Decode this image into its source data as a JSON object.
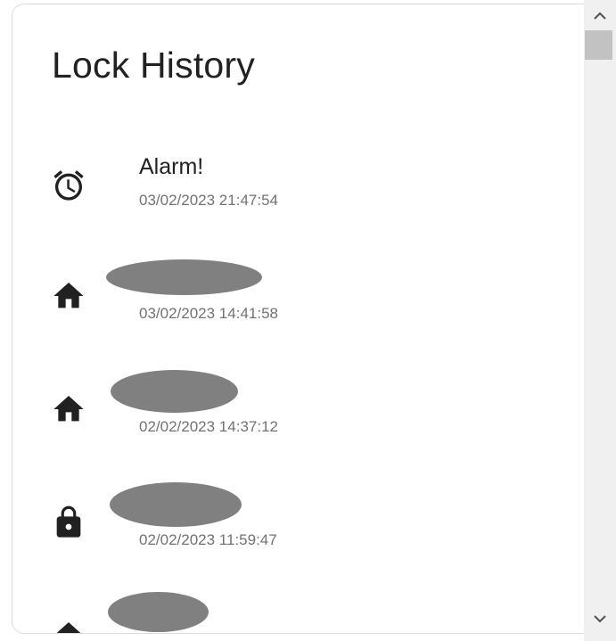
{
  "card": {
    "title": "Lock History"
  },
  "events": [
    {
      "icon": "alarm-clock-icon",
      "label": "Alarm!",
      "time": "03/02/2023 21:47:54"
    },
    {
      "icon": "home-icon",
      "label": "",
      "time": "03/02/2023 14:41:58"
    },
    {
      "icon": "home-icon",
      "label": "",
      "time": "02/02/2023 14:37:12"
    },
    {
      "icon": "lock-icon",
      "label": "",
      "time": "02/02/2023 11:59:47"
    },
    {
      "icon": "home-icon",
      "label": "",
      "time": ""
    }
  ],
  "colors": {
    "text_primary": "#212121",
    "text_secondary": "#727272",
    "redaction": "#808080"
  }
}
